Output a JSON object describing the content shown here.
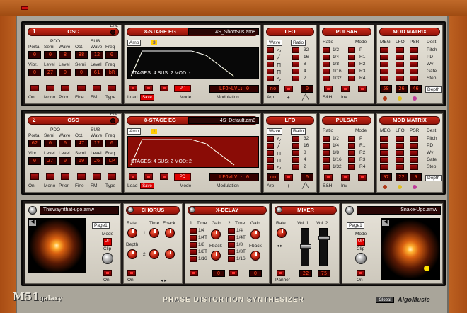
{
  "app": {
    "logo": "M51",
    "logo_sub": "galaxy",
    "title": "PHASE DISTORTION SYNTHESIZER",
    "brand": "AlgoMusic",
    "global": "Global"
  },
  "common": {
    "env": "Env.",
    "osc": "OSC",
    "eg": "8-STAGE EG",
    "lfo": "LFO",
    "pulsar": "PULSAR",
    "matrix": "MOD MATRIX",
    "pdo": "PDO",
    "sub": "SUB",
    "porta": "Porta",
    "semi": "Semi",
    "wave": "Wave",
    "freq": "Freq",
    "oct": "Oct.",
    "vibr": "Vibr.",
    "level": "Level",
    "on": "On",
    "mono": "Mono",
    "prior": "Prior.",
    "fine": "Fine",
    "fm": "FM",
    "type": "Type",
    "amp": "Amp",
    "load": "Load",
    "save": "Save",
    "mode": "Mode",
    "modulation": "Modulation",
    "ratio": "Ratio",
    "arp": "Arp",
    "sh": "S&H",
    "inv": "Inv",
    "meg": "MEG",
    "lfo_s": "LFO",
    "psr": "PSR",
    "dest": "Dest.",
    "depth": "Depth",
    "pd": "PD",
    "dests": [
      "Pitch",
      "PD",
      "Wv",
      "Gate",
      "Step"
    ],
    "pulsar_modes": [
      "P",
      "R1",
      "R2",
      "R3",
      "R4"
    ],
    "ratios": [
      "1/2",
      "1/4",
      "1/8",
      "1/16",
      "1/32"
    ],
    "lfo_vals": [
      "32",
      "16",
      "8",
      "4",
      "2"
    ]
  },
  "osc1": {
    "num": "1",
    "vals": [
      "0",
      "0",
      "8",
      "88",
      "12",
      "0",
      "0",
      "27",
      "0",
      "0",
      "61",
      "bR"
    ],
    "preset": "4S_ShortSus.am8",
    "stages": "STAGES: 4  SUS: 2  MOD: -",
    "lfo_lvl": "LFO>LVL: 0",
    "lfo_digits": [
      "no",
      "0"
    ],
    "meg": [
      "58",
      "26",
      "46"
    ],
    "eg_chip": "3"
  },
  "osc2": {
    "num": "2",
    "vals": [
      "62",
      "0",
      "0",
      "47",
      "12",
      "0",
      "0",
      "27",
      "0",
      "19",
      "26",
      "LP"
    ],
    "preset": "4S_Default.am8",
    "stages": "STAGES: 4  SUS: 2  MOD: 2",
    "lfo_lvl": "LFO>LVL: 0",
    "lfo_digits": [
      "no",
      "0"
    ],
    "meg": [
      "97",
      "22",
      "9"
    ],
    "eg_chip": "1"
  },
  "fx": {
    "img_left": "Thiswaynthat-ugo.amw",
    "img_right": "Snake-Ugo.amw",
    "page": "Page1",
    "mode": "Mode",
    "clip": "Clip",
    "chorus": "CHORUS",
    "rate": "Rate",
    "time": "Time",
    "fback": "Fback",
    "depth": "Depth",
    "xdelay": "X-DELAY",
    "one": "1",
    "two": "2",
    "gain": "Gain",
    "xvals": [
      "1/4",
      "1/4T",
      "1/8",
      "1/8T",
      "1/16"
    ],
    "xd1": "0",
    "xd2": "0",
    "mixer": "MIXER",
    "vol1": "Vol. 1",
    "vol2": "Vol. 2",
    "panner": "Panner",
    "mix_a": "22",
    "mix_b": "75",
    "up": "UP",
    "ch1": "1",
    "ch2": "2"
  }
}
